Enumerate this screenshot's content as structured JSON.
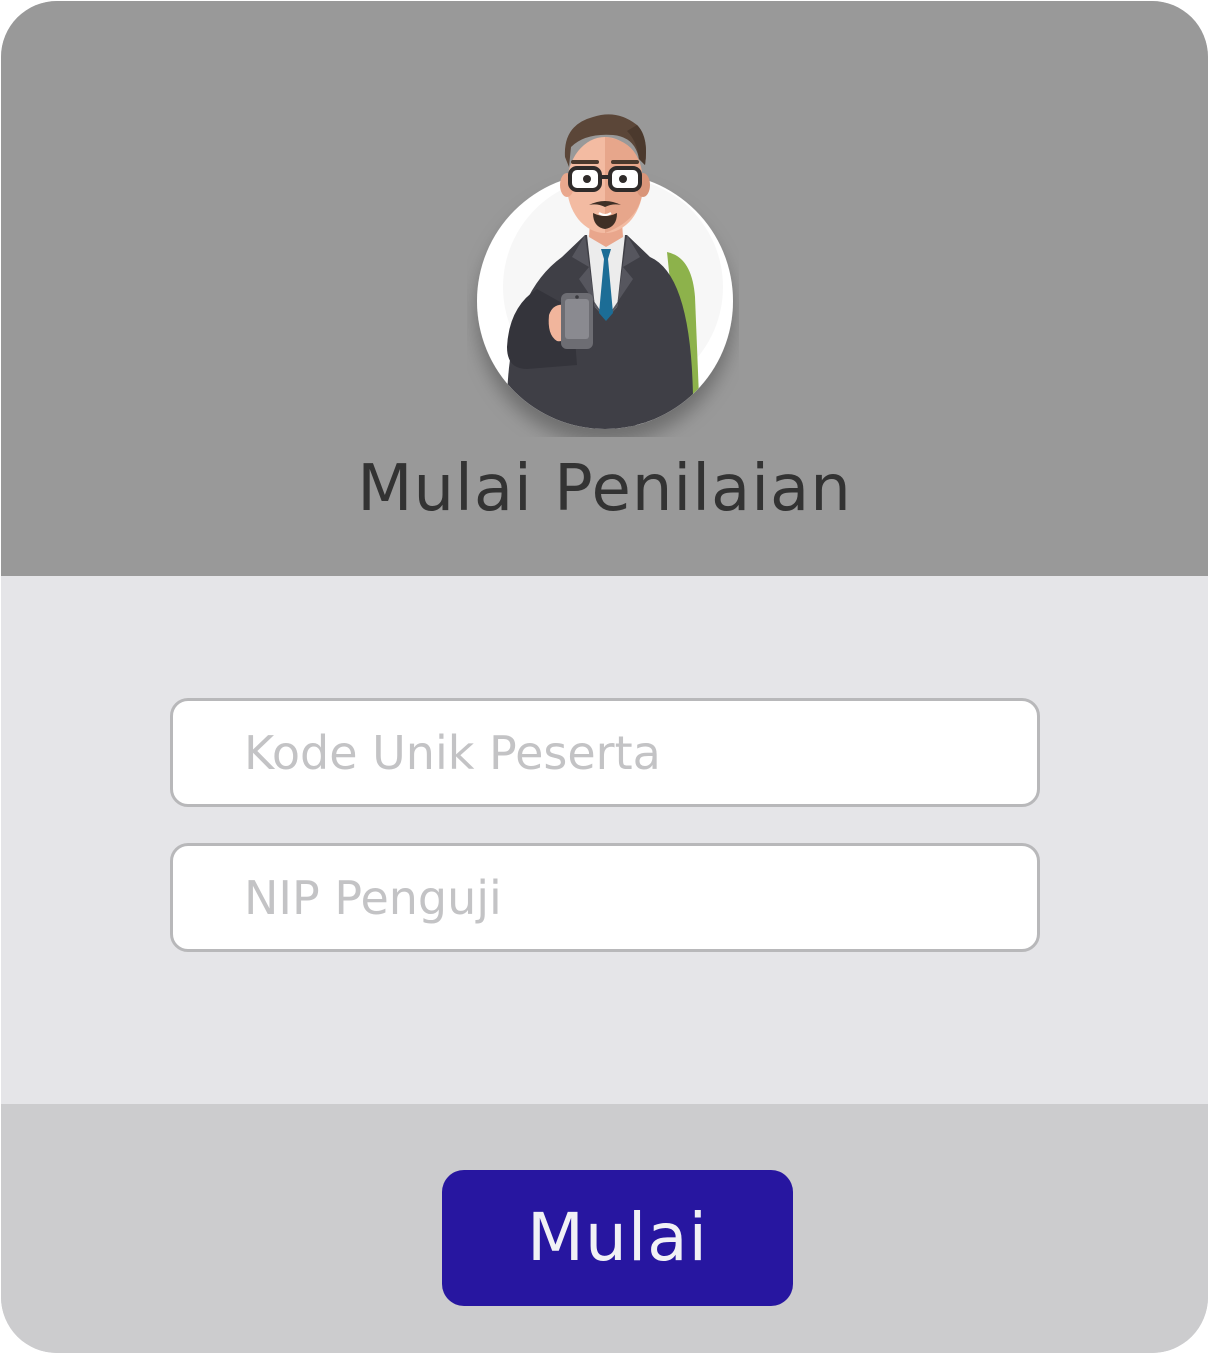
{
  "header": {
    "title": "Mulai Penilaian",
    "avatar_icon": "businessman-avatar-icon",
    "background_color": "#999999"
  },
  "form": {
    "fields": [
      {
        "placeholder": "Kode Unik Peserta",
        "value": ""
      },
      {
        "placeholder": "NIP Penguji",
        "value": ""
      }
    ],
    "background_color": "#e5e5e8"
  },
  "footer": {
    "start_label": "Mulai",
    "button_color": "#2716a0",
    "background_color": "#ccccce"
  }
}
